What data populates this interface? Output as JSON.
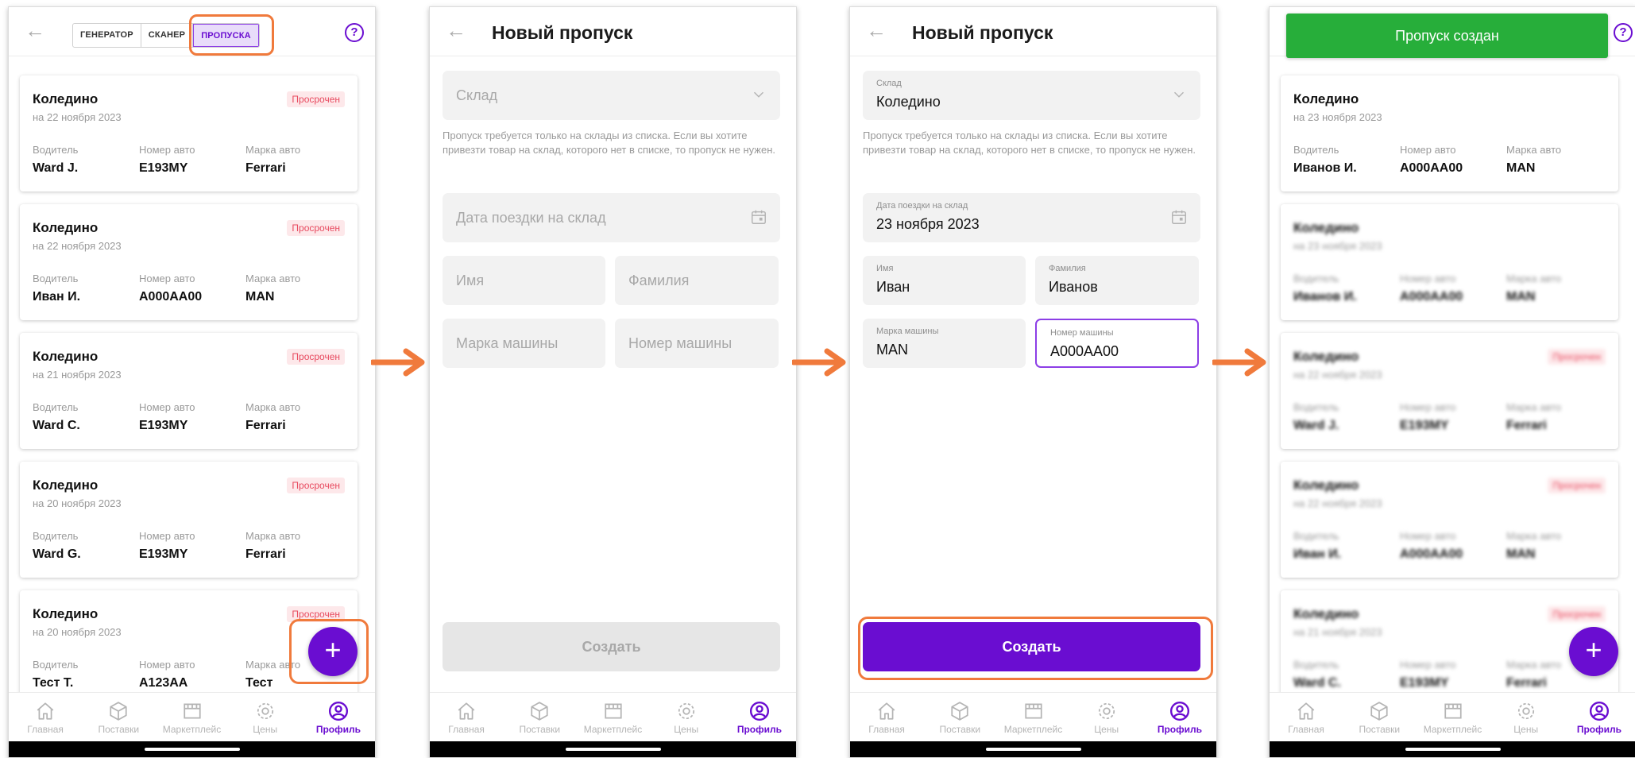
{
  "colors": {
    "accent": "#6a0dd1",
    "highlight": "#f07a3c",
    "expired": "#e84a5f",
    "success": "#27ae3a"
  },
  "tabs": [
    {
      "label": "Главная",
      "icon": "home-icon"
    },
    {
      "label": "Поставки",
      "icon": "box-icon"
    },
    {
      "label": "Маркетплейс",
      "icon": "store-icon"
    },
    {
      "label": "Цены",
      "icon": "gear-icon"
    },
    {
      "label": "Профиль",
      "icon": "profile-icon"
    }
  ],
  "screen1": {
    "segment": [
      "ГЕНЕРАТОР",
      "СКАНЕР",
      "ПРОПУСКА"
    ],
    "help": "?",
    "cards": [
      {
        "warehouse": "Коледино",
        "date": "на 22 ноября 2023",
        "status": "Просрочен",
        "driver": "Ward J.",
        "plate": "E193MY",
        "brand": "Ferrari"
      },
      {
        "warehouse": "Коледино",
        "date": "на 22 ноября 2023",
        "status": "Просрочен",
        "driver": "Иван И.",
        "plate": "A000AA00",
        "brand": "MAN"
      },
      {
        "warehouse": "Коледино",
        "date": "на 21 ноября 2023",
        "status": "Просрочен",
        "driver": "Ward C.",
        "plate": "E193MY",
        "brand": "Ferrari"
      },
      {
        "warehouse": "Коледино",
        "date": "на 20 ноября 2023",
        "status": "Просрочен",
        "driver": "Ward G.",
        "plate": "E193MY",
        "brand": "Ferrari"
      },
      {
        "warehouse": "Коледино",
        "date": "на 20 ноября 2023",
        "status": "Просрочен",
        "driver": "Тест Т.",
        "plate": "A123AA",
        "brand": "Тест"
      }
    ],
    "fab": "+"
  },
  "labels": {
    "driver": "Водитель",
    "plate": "Номер авто",
    "brand": "Марка авто"
  },
  "screen2": {
    "title": "Новый пропуск",
    "warehouse_ph": "Склад",
    "hint": "Пропуск требуется только на склады из списка. Если вы хотите привезти товар на склад, которого нет в списке, то пропуск не нужен.",
    "date_ph": "Дата поездки на склад",
    "name_ph": "Имя",
    "surname_ph": "Фамилия",
    "brand_ph": "Марка машины",
    "plate_ph": "Номер машины",
    "create": "Создать"
  },
  "screen3": {
    "title": "Новый пропуск",
    "warehouse_lbl": "Склад",
    "warehouse_val": "Коледино",
    "hint": "Пропуск требуется только на склады из списка. Если вы хотите привезти товар на склад, которого нет в списке, то пропуск не нужен.",
    "date_lbl": "Дата поездки на склад",
    "date_val": "23 ноября 2023",
    "name_lbl": "Имя",
    "name_val": "Иван",
    "surname_lbl": "Фамилия",
    "surname_val": "Иванов",
    "brand_lbl": "Марка машины",
    "brand_val": "MAN",
    "plate_lbl": "Номер машины",
    "plate_val": "A000AA00",
    "create": "Создать"
  },
  "screen4": {
    "toast": "Пропуск создан",
    "cards": [
      {
        "warehouse": "Коледино",
        "date": "на 23 ноября 2023",
        "status": "",
        "driver": "Иванов И.",
        "plate": "A000AA00",
        "brand": "MAN"
      },
      {
        "warehouse": "Коледино",
        "date": "на 23 ноября 2023",
        "status": "",
        "driver": "Иванов И.",
        "plate": "A000AA00",
        "brand": "MAN"
      },
      {
        "warehouse": "Коледино",
        "date": "на 22 ноября 2023",
        "status": "Просрочен",
        "driver": "Ward J.",
        "plate": "E193MY",
        "brand": "Ferrari"
      },
      {
        "warehouse": "Коледино",
        "date": "на 22 ноября 2023",
        "status": "Просрочен",
        "driver": "Иван И.",
        "plate": "A000AA00",
        "brand": "MAN"
      },
      {
        "warehouse": "Коледино",
        "date": "на 21 ноября 2023",
        "status": "Просрочен",
        "driver": "Ward C.",
        "plate": "E193MY",
        "brand": "Ferrari"
      }
    ],
    "fab": "+"
  }
}
